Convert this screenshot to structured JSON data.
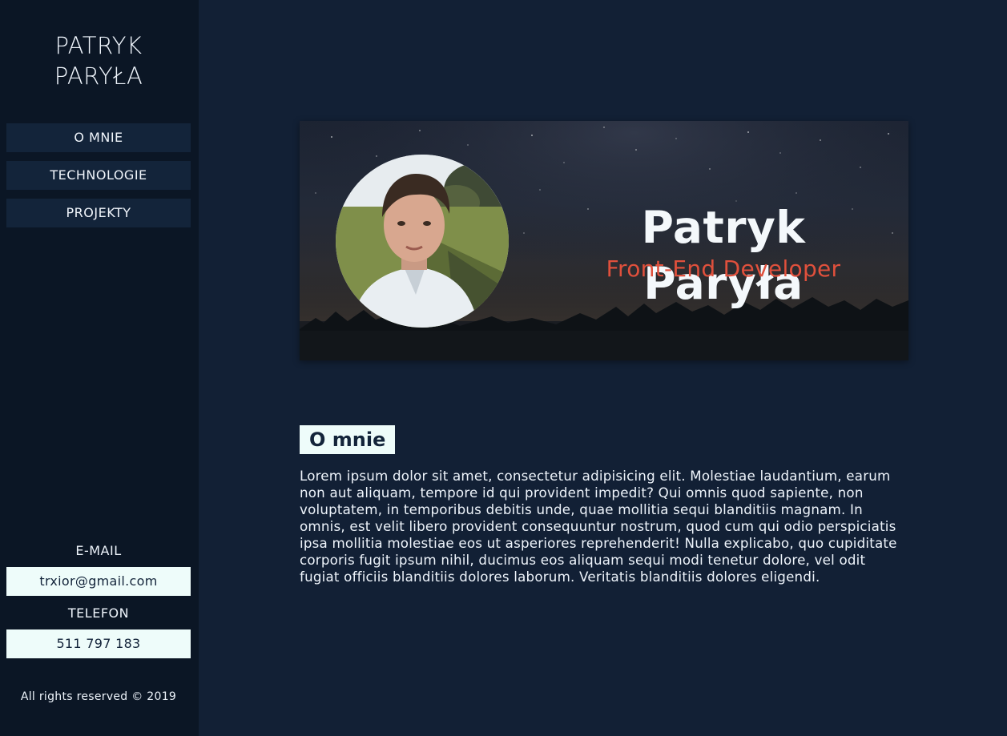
{
  "sidebar": {
    "brand_line1": "PATRYK",
    "brand_line2": "PARYŁA",
    "nav": [
      {
        "label": "O MNIE"
      },
      {
        "label": "TECHNOLOGIE"
      },
      {
        "label": "PROJEKTY"
      }
    ],
    "email_label": "E-MAIL",
    "email_value": "trxior@gmail.com",
    "phone_label": "TELEFON",
    "phone_value": "511 797 183",
    "footer": "All rights reserved © 2019"
  },
  "hero": {
    "name": "Patryk Paryła",
    "role": "Front-End Developer"
  },
  "about": {
    "title": "O mnie",
    "body": "Lorem ipsum dolor sit amet, consectetur adipisicing elit. Molestiae laudantium, earum non aut aliquam, tempore id qui provident impedit? Qui omnis quod sapiente, non voluptatem, in temporibus debitis unde, quae mollitia sequi blanditiis magnam. In omnis, est velit libero provident consequuntur nostrum, quod cum qui odio perspiciatis ipsa mollitia molestiae eos ut asperiores reprehenderit! Nulla explicabo, quo cupiditate corporis fugit ipsum nihil, ducimus eos aliquam sequi modi tenetur dolore, vel odit fugiat officiis blanditiis dolores laborum. Veritatis blanditiis dolores eligendi."
  },
  "colors": {
    "page_bg": "#122035",
    "sidebar_bg": "#0b1625",
    "nav_bg": "#13243a",
    "accent": "#e0503c",
    "light_box": "#eefcfa"
  }
}
